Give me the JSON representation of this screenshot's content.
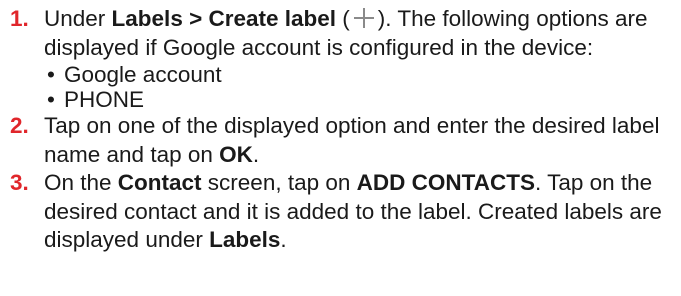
{
  "steps": [
    {
      "number": "1.",
      "t1": "Under ",
      "b1": "Labels > Create label",
      "t2": " (",
      "icon": "plus-icon",
      "t3": "). The following options are displayed if Google account is configured in the device:",
      "options": [
        "Google account",
        "PHONE"
      ]
    },
    {
      "number": "2.",
      "t1": "Tap on one of the displayed option and enter the desired label name and tap on ",
      "b1": "OK",
      "t2": "."
    },
    {
      "number": "3.",
      "t1": "On the ",
      "b1": "Contact",
      "t2": " screen, tap on ",
      "b2": "ADD CONTACTS",
      "t3": ". Tap on the desired contact and it is added to the label. Created labels are displayed under ",
      "b3": "Labels",
      "t4": "."
    }
  ],
  "colors": {
    "step_number": "#e0262b",
    "text": "#1a1a1a",
    "icon": "#8a8a8a"
  }
}
